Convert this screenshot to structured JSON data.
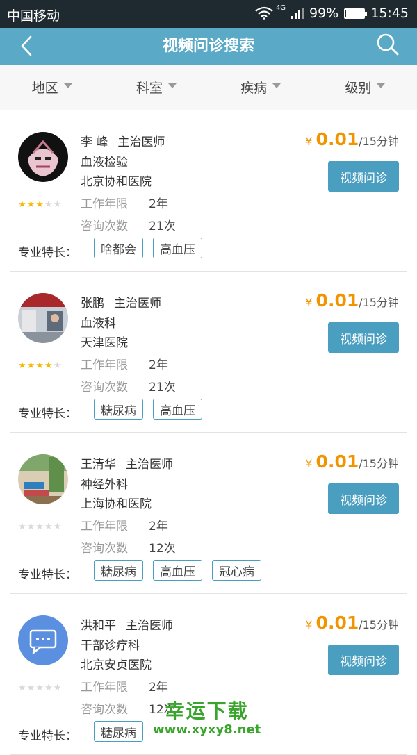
{
  "status": {
    "carrier": "中国移动",
    "network": "4G",
    "battery": "99%",
    "time": "15:45",
    "battery_level": 0.99
  },
  "header": {
    "title": "视频问诊搜索",
    "back_icon": "chevron-left-icon",
    "search_icon": "search-icon"
  },
  "filters": [
    {
      "label": "地区"
    },
    {
      "label": "科室"
    },
    {
      "label": "疾病"
    },
    {
      "label": "级别"
    }
  ],
  "labels": {
    "work_years": "工作年限",
    "consult_count": "咨询次数",
    "specialty": "专业特长：",
    "button": "视频问诊",
    "yen": "¥",
    "per": "/15分钟"
  },
  "doctors": [
    {
      "name": "李 峰",
      "title": "主治医师",
      "dept": "血液检验",
      "hospital": "北京协和医院",
      "years": "2年",
      "consults": "21次",
      "price": "0.01",
      "rating": 3,
      "tags": [
        "啥都会",
        "高血压"
      ]
    },
    {
      "name": "张鹏",
      "title": "主治医师",
      "dept": "血液科",
      "hospital": "天津医院",
      "years": "2年",
      "consults": "21次",
      "price": "0.01",
      "rating": 4,
      "tags": [
        "糖尿病",
        "高血压"
      ]
    },
    {
      "name": "王清华",
      "title": "主治医师",
      "dept": "神经外科",
      "hospital": "上海协和医院",
      "years": "2年",
      "consults": "12次",
      "price": "0.01",
      "rating": 0,
      "tags": [
        "糖尿病",
        "高血压",
        "冠心病"
      ]
    },
    {
      "name": "洪和平",
      "title": "主治医师",
      "dept": "干部诊疗科",
      "hospital": "北京安贞医院",
      "years": "2年",
      "consults": "12次",
      "price": "0.01",
      "rating": 0,
      "tags": [
        "糖尿病"
      ]
    }
  ],
  "watermark": {
    "title": "幸运下载",
    "url": "www.xyxy8.net"
  },
  "colors": {
    "header": "#5aaac7",
    "accent": "#4a9ec0",
    "price": "#f29400",
    "star": "#f5b800"
  }
}
